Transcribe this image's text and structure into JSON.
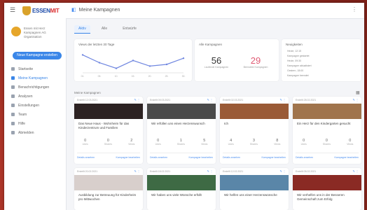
{
  "app": {
    "logo": {
      "brand_a": "ESSEN",
      "brand_b": "MIT"
    },
    "page_title": "Meine Kampagnen",
    "org": {
      "name": "Essen mit Herz Kampagnen AG",
      "sub": "Organisation"
    }
  },
  "sidebar": {
    "new_button": "Neue Kampagne erstellen",
    "items": [
      {
        "label": "Startseite"
      },
      {
        "label": "Meine Kampagnen",
        "active": true
      },
      {
        "label": "Benachrichtigungen"
      },
      {
        "label": "Analysen"
      },
      {
        "label": "Einstellungen"
      },
      {
        "label": "Team"
      },
      {
        "label": "Hilfe"
      },
      {
        "label": "Abmelden"
      }
    ]
  },
  "tabs": [
    {
      "label": "Aktiv",
      "active": true
    },
    {
      "label": "Alle"
    },
    {
      "label": "Entwürfe"
    }
  ],
  "cards": {
    "chart": {
      "title": "Views der letzten 30 Tage"
    },
    "stats": {
      "title": "Alle Kampagnen",
      "items": [
        {
          "value": "56",
          "label": "Laufende Kampagnen",
          "color": "#666666"
        },
        {
          "value": "29",
          "label": "Beendete Kampagnen",
          "color": "#e05a73"
        }
      ]
    },
    "status": {
      "title": "Neuigkeiten",
      "items": [
        "Heute, 12:15",
        "Kampagne gestartet",
        "Heute, 09:30",
        "Kampagne aktualisiert",
        "Gestern, 18:00",
        "Kampagne beendet"
      ]
    }
  },
  "campaigns_label": "Meine Kampagnen",
  "chart_data": {
    "type": "line",
    "title": "Views der letzten 30 Tage",
    "x": [
      "01.",
      "05.",
      "10.",
      "15.",
      "20.",
      "25.",
      "30."
    ],
    "series": [
      {
        "values": [
          32,
          18,
          8,
          22,
          12,
          15,
          26
        ]
      }
    ],
    "ylim": [
      0,
      40
    ],
    "grid": false
  },
  "campaigns": [
    {
      "meta": "Erstellt 12.03.2021",
      "title": "Das Neue Haus - Wohnheim für das Kinderzentrum und Familien",
      "image": "#2c2222",
      "kpis": [
        {
          "n": "0",
          "l": "Likes"
        },
        {
          "n": "0",
          "l": "Shares"
        },
        {
          "n": "2",
          "l": "Views"
        }
      ],
      "foot_left": "Details ansehen",
      "foot_right": "Kampagne bearbeiten"
    },
    {
      "meta": "Erstellt 09.03.2021",
      "title": "Wir erfüllen uns einen Herzenswunsch",
      "image": "#4a4a4a",
      "kpis": [
        {
          "n": "0",
          "l": "Likes"
        },
        {
          "n": "1",
          "l": "Shares"
        },
        {
          "n": "5",
          "l": "Views"
        }
      ],
      "foot_left": "Details ansehen",
      "foot_right": "Kampagne bearbeiten"
    },
    {
      "meta": "Erstellt 02.03.2021",
      "title": "Ich",
      "image": "#9a5a36",
      "kpis": [
        {
          "n": "4",
          "l": "Likes"
        },
        {
          "n": "3",
          "l": "Shares"
        },
        {
          "n": "8",
          "l": "Views"
        }
      ],
      "foot_left": "Details ansehen",
      "foot_right": "Kampagne bearbeiten"
    },
    {
      "meta": "Erstellt 28.02.2021",
      "title": "Ein Herz für den Kindergarten gesucht",
      "image": "#a0744c",
      "kpis": [
        {
          "n": "0",
          "l": "Likes"
        },
        {
          "n": "0",
          "l": "Shares"
        },
        {
          "n": "0",
          "l": "Views"
        }
      ],
      "foot_left": "Details ansehen",
      "foot_right": "Kampagne bearbeiten"
    },
    {
      "meta": "Erstellt 20.02.2021",
      "title": "Ausbildung zur Betreuung für Kinderheim pro Mittwochen",
      "image": "#d8cfcc",
      "kpis": [],
      "foot_left": "",
      "foot_right": ""
    },
    {
      "meta": "Erstellt 18.02.2021",
      "title": "Wir haben uns viele Wünsche erfüllt",
      "image": "#3e6a44",
      "kpis": [],
      "foot_left": "",
      "foot_right": ""
    },
    {
      "meta": "Erstellt 12.02.2021",
      "title": "Wir helfen uns einer Herzenswünsche",
      "image": "#5a86a8",
      "kpis": [],
      "foot_left": "",
      "foot_right": ""
    },
    {
      "meta": "Erstellt 05.02.2021",
      "title": "Wir verhelfen uns in der Besseren Gemeinschaft zum Erfolg",
      "image": "#8a2a24",
      "kpis": [],
      "foot_left": "",
      "foot_right": ""
    }
  ]
}
